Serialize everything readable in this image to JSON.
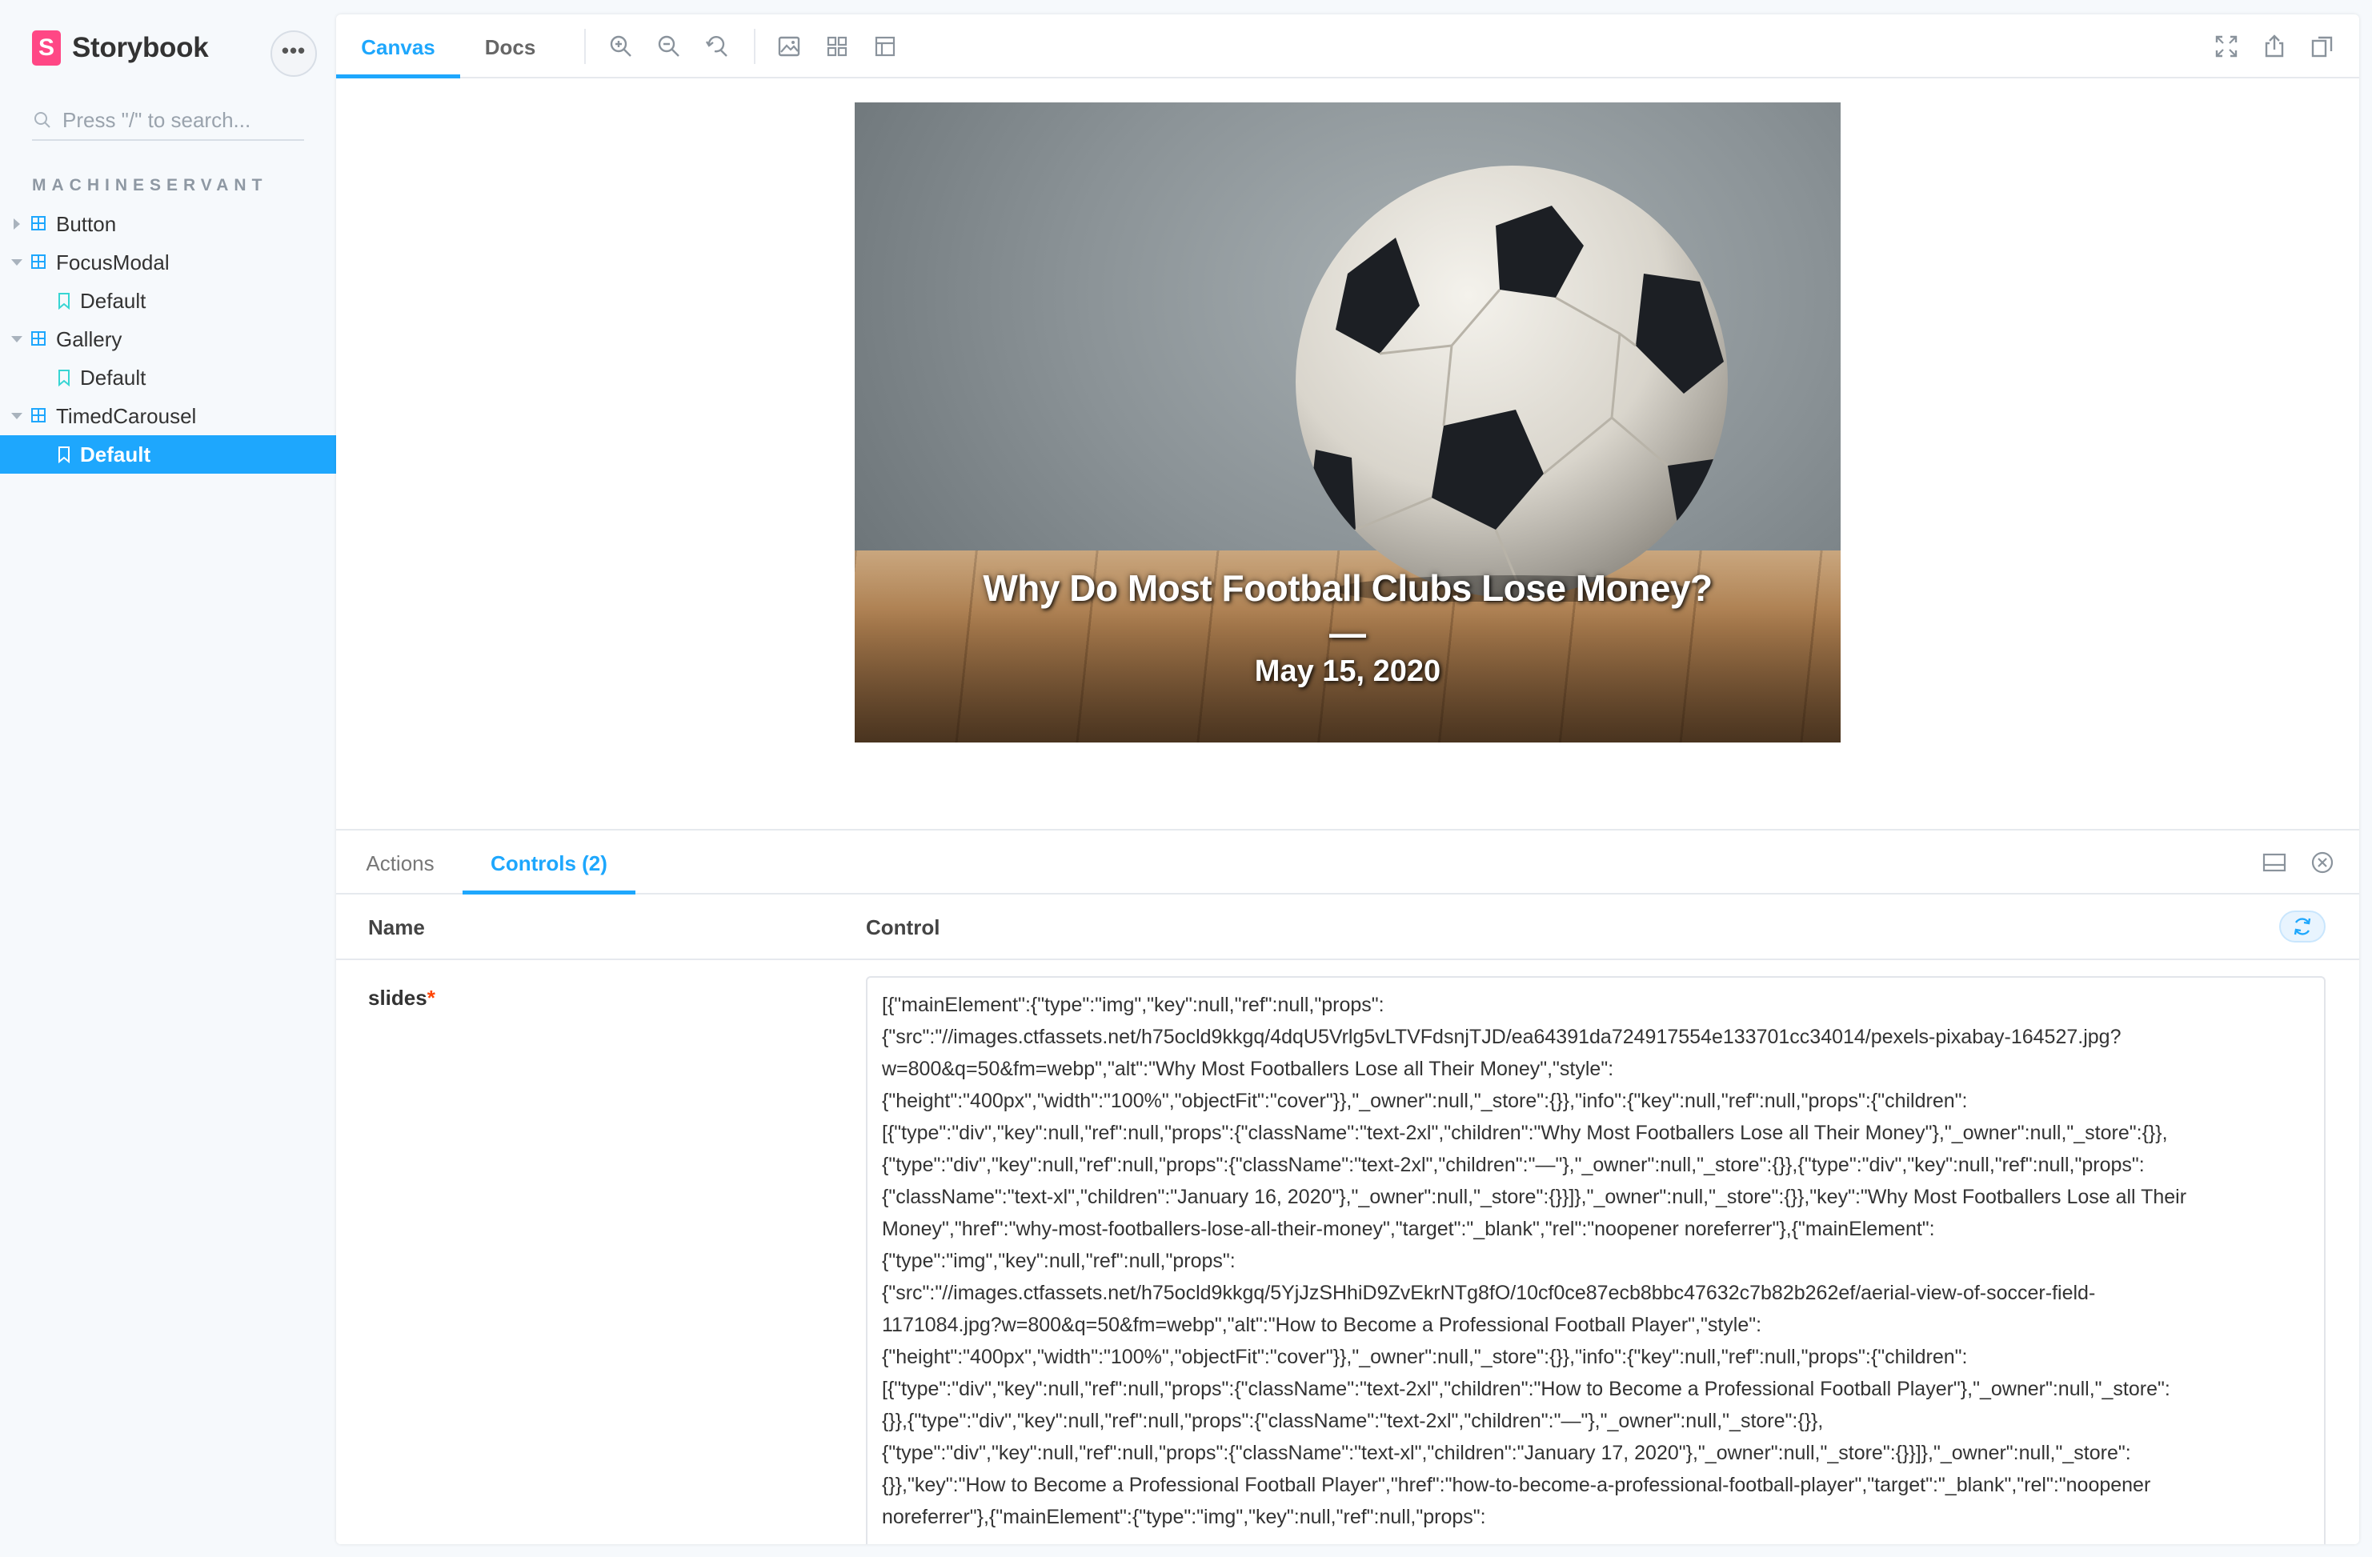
{
  "app": {
    "brand": "Storybook",
    "brand_glyph": "S",
    "menu_glyph": "•••"
  },
  "sidebar": {
    "search_placeholder": "Press \"/\" to search...",
    "section_title": "MACHINESERVANT",
    "items": [
      {
        "label": "Button",
        "type": "component",
        "expanded": false
      },
      {
        "label": "FocusModal",
        "type": "component",
        "expanded": true
      },
      {
        "label": "Default",
        "type": "story"
      },
      {
        "label": "Gallery",
        "type": "component",
        "expanded": true
      },
      {
        "label": "Default",
        "type": "story"
      },
      {
        "label": "TimedCarousel",
        "type": "component",
        "expanded": true
      },
      {
        "label": "Default",
        "type": "story",
        "selected": true
      }
    ]
  },
  "toolbar": {
    "tabs": [
      {
        "label": "Canvas",
        "active": true
      },
      {
        "label": "Docs",
        "active": false
      }
    ],
    "tools": [
      "zoom-in-icon",
      "zoom-out-icon",
      "zoom-reset-icon",
      "background-icon",
      "grid-icon",
      "measure-icon"
    ],
    "right_tools": [
      "fullscreen-icon",
      "share-icon",
      "copy-link-icon"
    ]
  },
  "slide": {
    "title": "Why Do Most Football Clubs Lose Money?",
    "separator": "—",
    "date": "May 15, 2020"
  },
  "addons": {
    "tabs": [
      {
        "label": "Actions",
        "active": false
      },
      {
        "label": "Controls (2)",
        "active": true
      }
    ],
    "header": {
      "name": "Name",
      "control": "Control"
    },
    "row": {
      "name": "slides",
      "required_mark": "*",
      "value": "[{\"mainElement\":{\"type\":\"img\",\"key\":null,\"ref\":null,\"props\":\n{\"src\":\"//images.ctfassets.net/h75ocld9kkgq/4dqU5Vrlg5vLTVFdsnjTJD/ea64391da724917554e133701cc34014/pexels-pixabay-164527.jpg?\nw=800&q=50&fm=webp\",\"alt\":\"Why Most Footballers Lose all Their Money\",\"style\":\n{\"height\":\"400px\",\"width\":\"100%\",\"objectFit\":\"cover\"}},\"_owner\":null,\"_store\":{}},\"info\":{\"key\":null,\"ref\":null,\"props\":{\"children\":\n[{\"type\":\"div\",\"key\":null,\"ref\":null,\"props\":{\"className\":\"text-2xl\",\"children\":\"Why Most Footballers Lose all Their Money\"},\"_owner\":null,\"_store\":{}},\n{\"type\":\"div\",\"key\":null,\"ref\":null,\"props\":{\"className\":\"text-2xl\",\"children\":\"—\"},\"_owner\":null,\"_store\":{}},{\"type\":\"div\",\"key\":null,\"ref\":null,\"props\":\n{\"className\":\"text-xl\",\"children\":\"January 16, 2020\"},\"_owner\":null,\"_store\":{}}]},\"_owner\":null,\"_store\":{}},\"key\":\"Why Most Footballers Lose all Their\nMoney\",\"href\":\"why-most-footballers-lose-all-their-money\",\"target\":\"_blank\",\"rel\":\"noopener noreferrer\"},{\"mainElement\":\n{\"type\":\"img\",\"key\":null,\"ref\":null,\"props\":\n{\"src\":\"//images.ctfassets.net/h75ocld9kkgq/5YjJzSHhiD9ZvEkrNTg8fO/10cf0ce87ecb8bbc47632c7b82b262ef/aerial-view-of-soccer-field-\n1171084.jpg?w=800&q=50&fm=webp\",\"alt\":\"How to Become a Professional Football Player\",\"style\":\n{\"height\":\"400px\",\"width\":\"100%\",\"objectFit\":\"cover\"}},\"_owner\":null,\"_store\":{}},\"info\":{\"key\":null,\"ref\":null,\"props\":{\"children\":\n[{\"type\":\"div\",\"key\":null,\"ref\":null,\"props\":{\"className\":\"text-2xl\",\"children\":\"How to Become a Professional Football Player\"},\"_owner\":null,\"_store\":\n{}},{\"type\":\"div\",\"key\":null,\"ref\":null,\"props\":{\"className\":\"text-2xl\",\"children\":\"—\"},\"_owner\":null,\"_store\":{}},\n{\"type\":\"div\",\"key\":null,\"ref\":null,\"props\":{\"className\":\"text-xl\",\"children\":\"January 17, 2020\"},\"_owner\":null,\"_store\":{}}]},\"_owner\":null,\"_store\":\n{}},\"key\":\"How to Become a Professional Football Player\",\"href\":\"how-to-become-a-professional-football-player\",\"target\":\"_blank\",\"rel\":\"noopener\nnoreferrer\"},{\"mainElement\":{\"type\":\"img\",\"key\":null,\"ref\":null,\"props\":"
    }
  },
  "colors": {
    "accent": "#1ea7fd",
    "brand": "#ff4785",
    "required": "#ff4400"
  }
}
